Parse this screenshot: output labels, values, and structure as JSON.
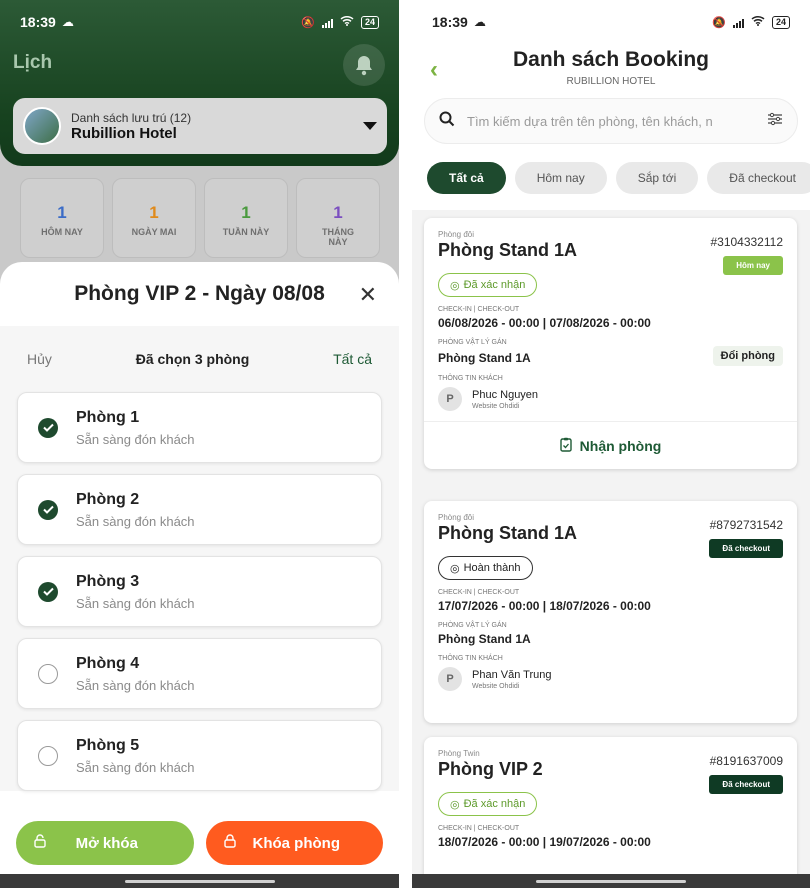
{
  "left": {
    "status": {
      "time": "18:39",
      "battery": "24"
    },
    "header_title": "Lịch",
    "hotel": {
      "subtitle": "Danh sách lưu trú (12)",
      "name": "Rubillion Hotel"
    },
    "stats": [
      {
        "value": "1",
        "label": "HÔM NAY",
        "color": "#3b6cc7"
      },
      {
        "value": "1",
        "label": "NGÀY MAI",
        "color": "#e08a1a"
      },
      {
        "value": "1",
        "label": "TUẦN NÀY",
        "color": "#4a9a3e"
      },
      {
        "value": "1",
        "label": "THÁNG NÀY",
        "color": "#7b4fc0"
      }
    ],
    "sheet": {
      "title": "Phòng VIP 2 - Ngày 08/08",
      "cancel": "Hủy",
      "selected": "Đã chọn 3 phòng",
      "select_all": "Tất cả",
      "rooms": [
        {
          "name": "Phòng 1",
          "status": "Sẵn sàng đón khách",
          "checked": true
        },
        {
          "name": "Phòng 2",
          "status": "Sẵn sàng đón khách",
          "checked": true
        },
        {
          "name": "Phòng 3",
          "status": "Sẵn sàng đón khách",
          "checked": true
        },
        {
          "name": "Phòng 4",
          "status": "Sẵn sàng đón khách",
          "checked": false
        },
        {
          "name": "Phòng 5",
          "status": "Sẵn sàng đón khách",
          "checked": false
        }
      ],
      "unlock_label": "Mở khóa",
      "lock_label": "Khóa phòng"
    }
  },
  "right": {
    "status": {
      "time": "18:39",
      "battery": "24"
    },
    "title": "Danh sách Booking",
    "subtitle": "RUBILLION HOTEL",
    "search_placeholder": "Tìm kiếm dựa trên tên phòng, tên khách, n",
    "tabs": [
      "Tất cả",
      "Hôm nay",
      "Sắp tới",
      "Đã checkout"
    ],
    "labels": {
      "checkin_checkout": "CHECK-IN | CHECK-OUT",
      "assigned_room": "PHÒNG VẬT LÝ GÁN",
      "guest_info": "THÔNG TIN KHÁCH"
    },
    "bookings": [
      {
        "room_type": "Phòng đôi",
        "room": "Phòng Stand 1A",
        "code": "#3104332112",
        "badge": "Hôm nay",
        "state": "Đã xác nhận",
        "dates": "06/08/2026 - 00:00  |  07/08/2026 - 00:00",
        "assigned": "Phòng Stand 1A",
        "change_label": "Đổi phòng",
        "guest_initial": "P",
        "guest": "Phuc Nguyen",
        "source": "Website Ohdidi",
        "action": "Nhận phòng"
      },
      {
        "room_type": "Phòng đôi",
        "room": "Phòng Stand 1A",
        "code": "#8792731542",
        "badge": "Đã checkout",
        "state": "Hoàn thành",
        "dates": "17/07/2026 - 00:00  |  18/07/2026 - 00:00",
        "assigned": "Phòng Stand 1A",
        "guest_initial": "P",
        "guest": "Phan Văn Trung",
        "source": "Website Ohdidi"
      },
      {
        "room_type": "Phòng Twin",
        "room": "Phòng VIP 2",
        "code": "#8191637009",
        "badge": "Đã checkout",
        "state": "Đã xác nhận",
        "dates": "18/07/2026 - 00:00  |  19/07/2026 - 00:00"
      }
    ]
  },
  "colors": {
    "brand_green": "#1e4a2e",
    "accent_lime": "#8bc34a",
    "accent_orange": "#ff5b1f"
  }
}
